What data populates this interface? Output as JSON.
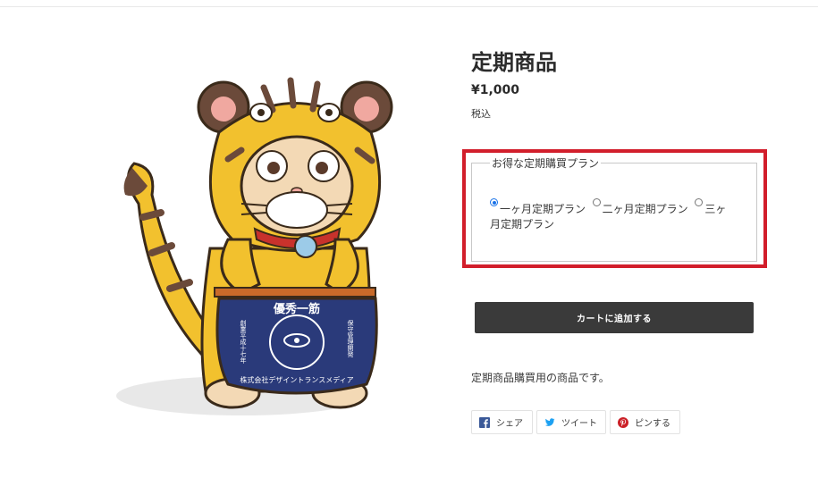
{
  "product": {
    "title": "定期商品",
    "price": "¥1,000",
    "tax_note": "税込",
    "description": "定期商品購買用の商品です。",
    "cart_button_label": "カートに追加する"
  },
  "plan": {
    "legend": "お得な定期購買プラン",
    "options": [
      {
        "label": "一ヶ月定期プラン",
        "checked": true
      },
      {
        "label": "二ヶ月定期プラン",
        "checked": false
      },
      {
        "label": "三ヶ月定期プラン",
        "checked": false
      }
    ]
  },
  "share": {
    "facebook_label": "シェア",
    "twitter_label": "ツイート",
    "pinterest_label": "ピンする"
  },
  "image": {
    "banner_text_top": "優秀一筋",
    "banner_text_bottom": "株式会社デザイントランスメディア",
    "banner_side_left": "創業平成十七年",
    "banner_side_right": "保守管理開発"
  },
  "colors": {
    "highlight": "#d21e2b",
    "button_bg": "#3a3a3a",
    "facebook": "#3b5998",
    "twitter": "#1da1f2",
    "pinterest": "#cb2027",
    "radio_accent": "#1a73e8"
  }
}
